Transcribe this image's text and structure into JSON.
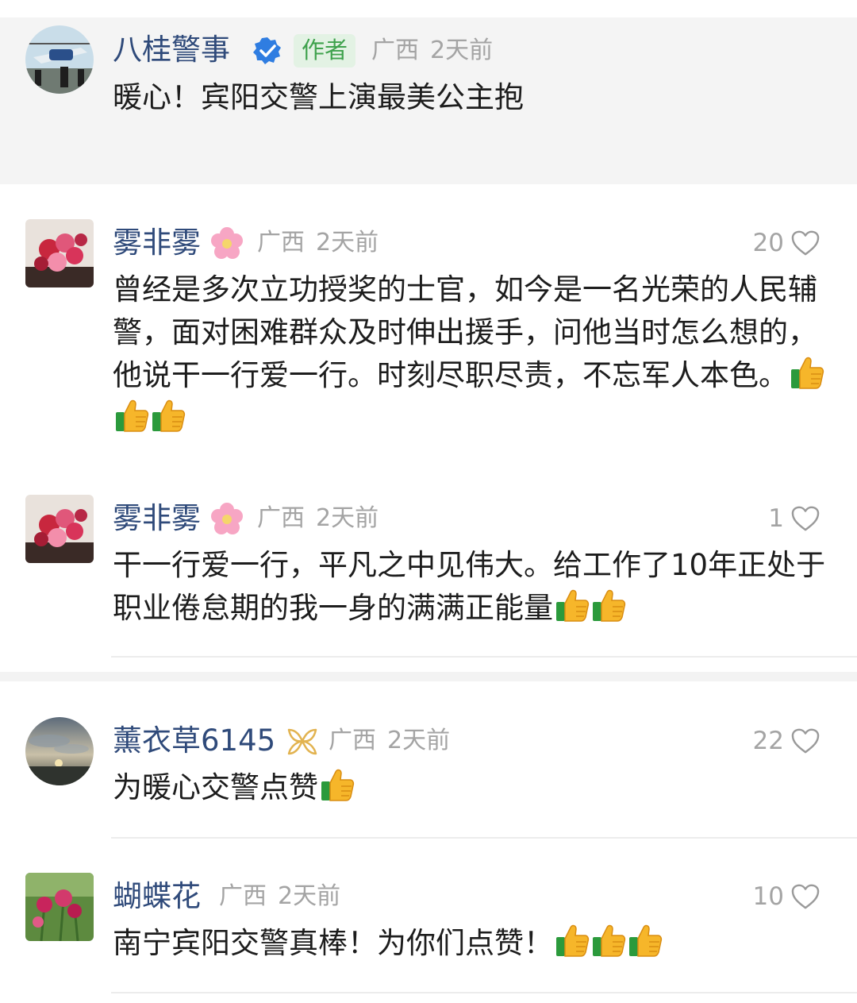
{
  "author_post": {
    "name": "八桂警事",
    "verified_icon": "verified-badge-icon",
    "author_tag": "作者",
    "location": "广西",
    "time": "2天前",
    "text": "暖心！宾阳交警上演最美公主抱"
  },
  "comments": [
    {
      "name": "雾非雾",
      "name_icon": "pink-flower-icon",
      "location": "广西",
      "time": "2天前",
      "likes": "20",
      "text": "曾经是多次立功授奖的士官，如今是一名光荣的人民辅警，面对困难群众及时伸出援手，问他当时怎么想的，他说干一行爱一行。时刻尽职尽责，不忘军人本色。",
      "thumbs_count": 3
    },
    {
      "name": "雾非雾",
      "name_icon": "pink-flower-icon",
      "location": "广西",
      "time": "2天前",
      "likes": "1",
      "text": "干一行爱一行，平凡之中见伟大。给工作了10年正处于职业倦怠期的我一身的满满正能量",
      "thumbs_count": 2
    },
    {
      "name": "薰衣草6145",
      "name_icon": "gold-ribbon-icon",
      "location": "广西",
      "time": "2天前",
      "likes": "22",
      "text": "为暖心交警点赞",
      "thumbs_count": 1
    },
    {
      "name": "蝴蝶花",
      "location": "广西",
      "time": "2天前",
      "likes": "10",
      "text": "南宁宾阳交警真棒！为你们点赞！",
      "thumbs_count": 3
    }
  ],
  "colors": {
    "username": "#2f4a7a",
    "meta": "#a4a4a4",
    "author_badge_bg": "#e3f2e4",
    "author_badge_text": "#3fa24d",
    "verified_blue": "#2f7de1"
  }
}
